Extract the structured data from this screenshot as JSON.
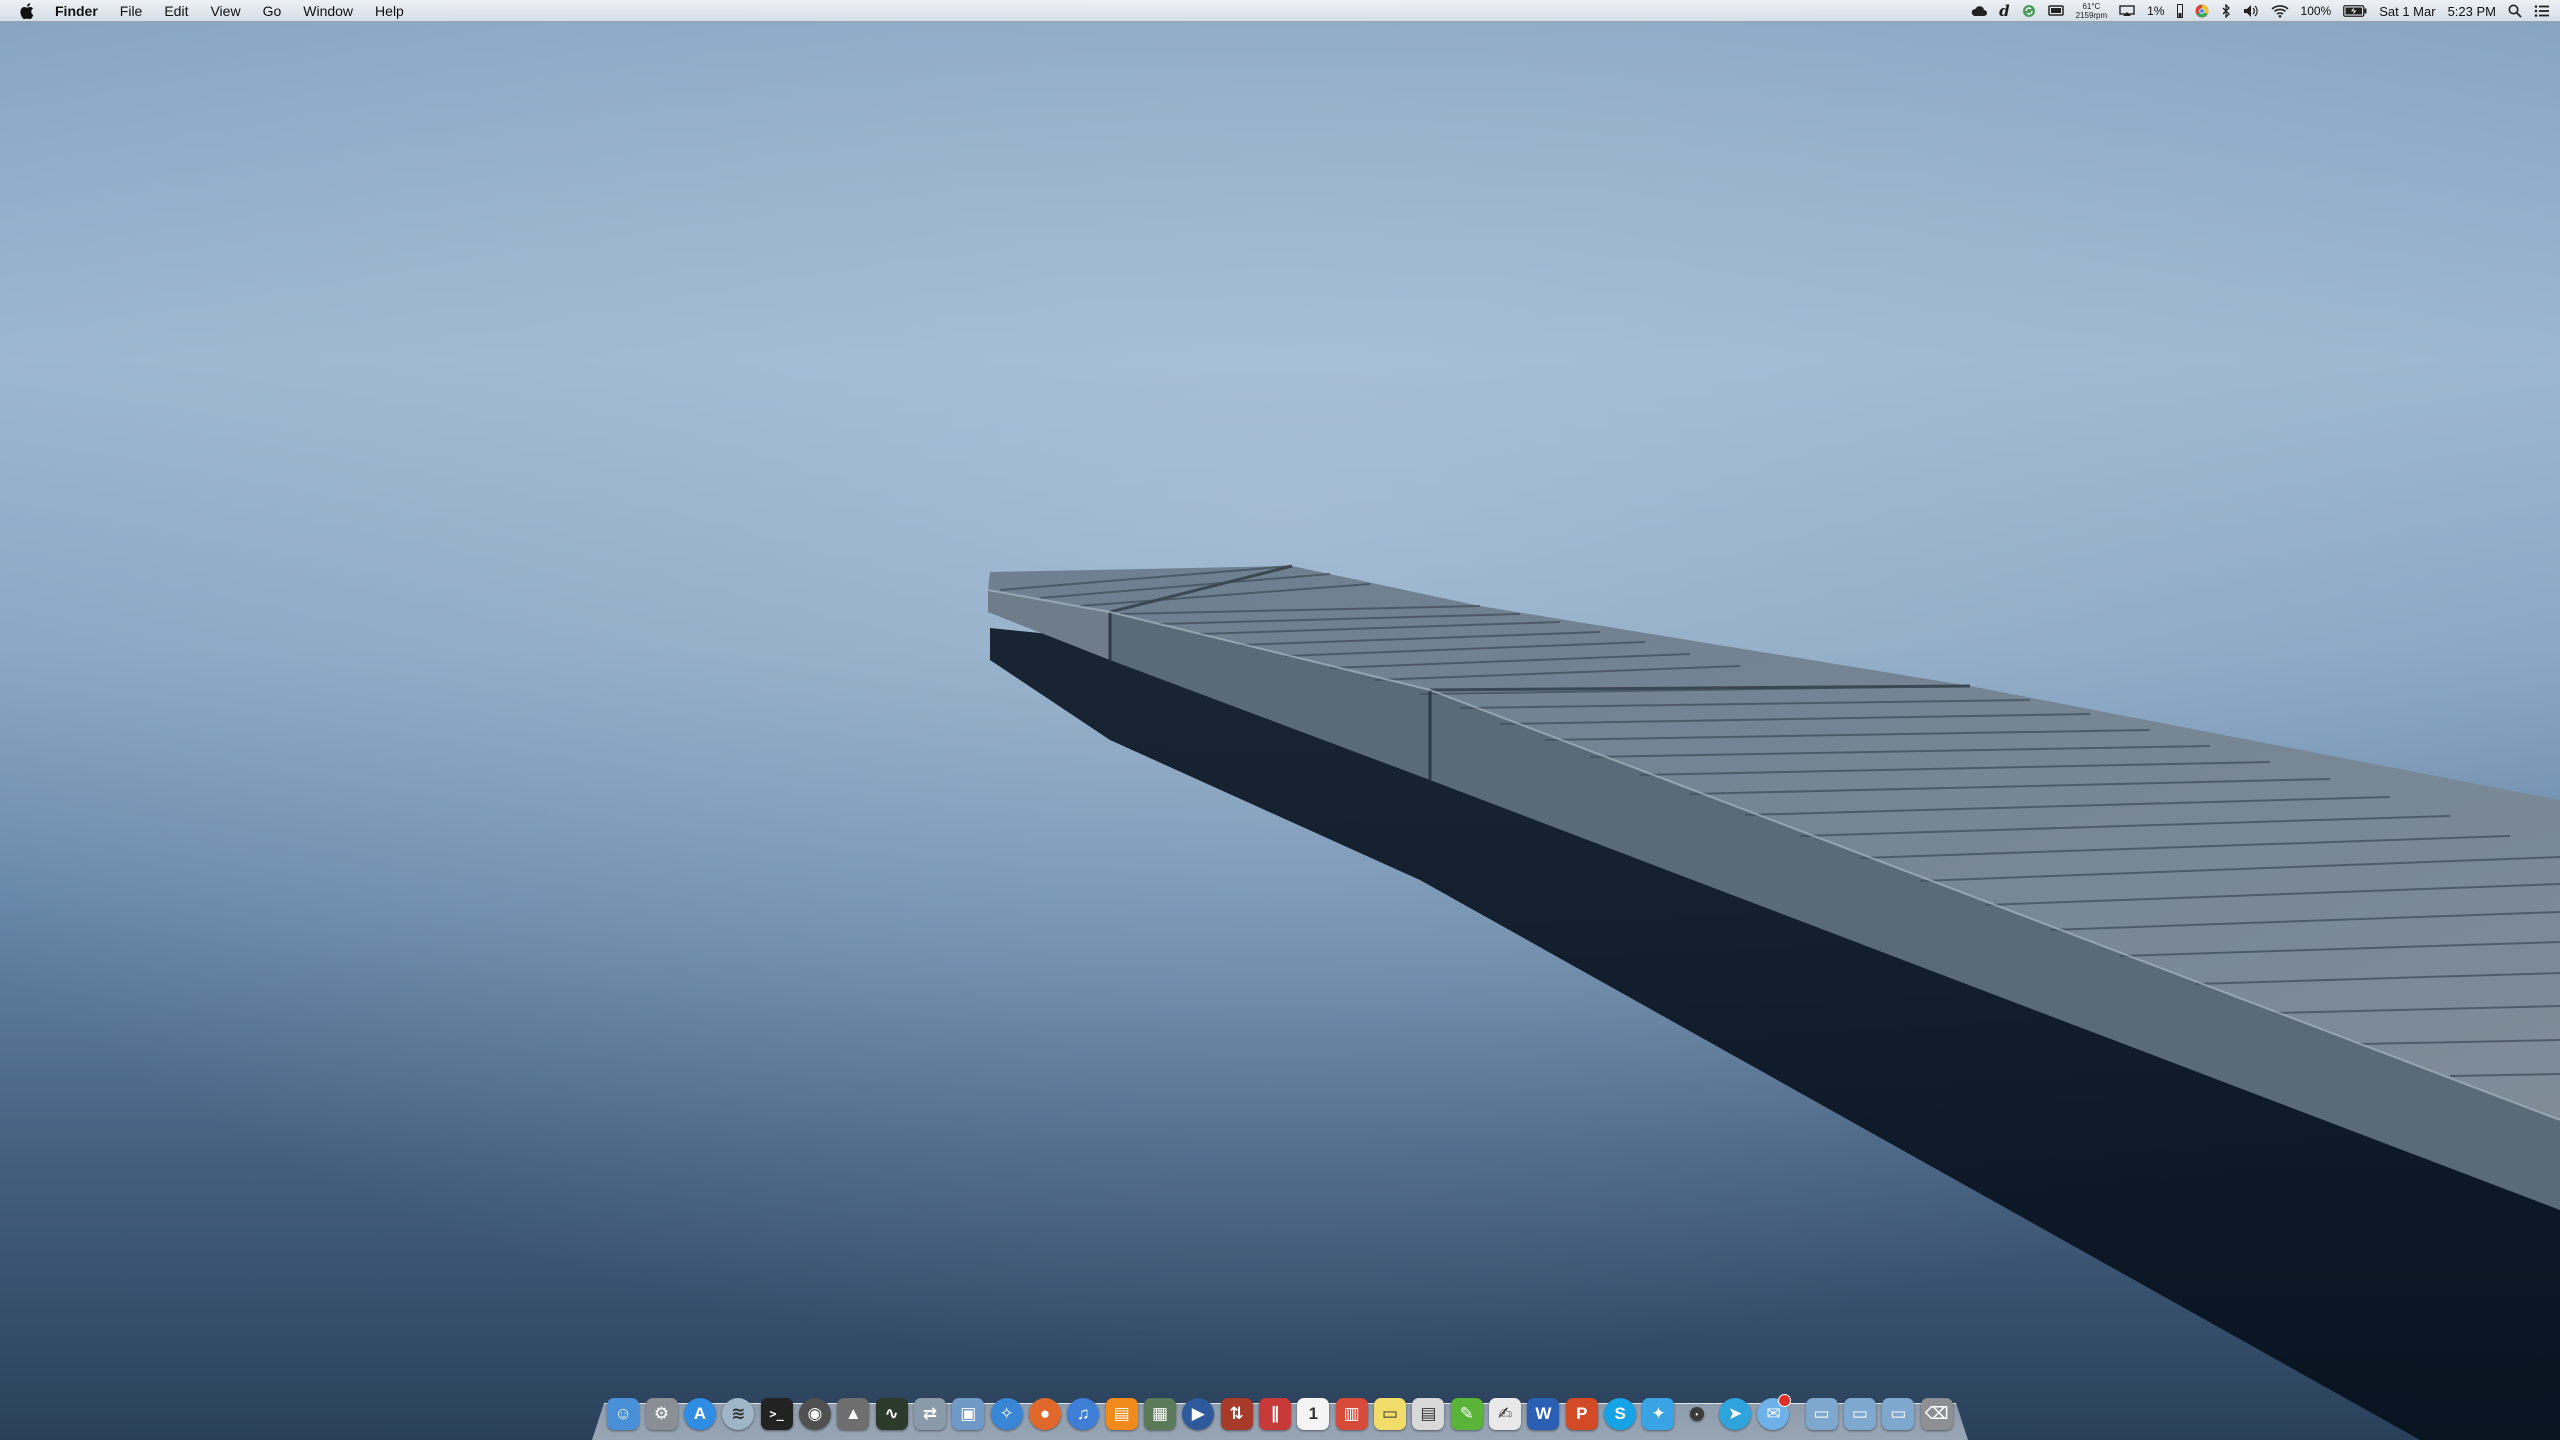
{
  "menubar": {
    "apple_icon": "apple-logo-icon",
    "app_name": "Finder",
    "menus": [
      "File",
      "Edit",
      "View",
      "Go",
      "Window",
      "Help"
    ],
    "status": {
      "icons": [
        "cloud-icon",
        "dictionary-icon",
        "recycle-icon",
        "display-icon"
      ],
      "temperature": "61°C",
      "fan_speed": "2159rpm",
      "airplay_icon": "airplay-icon",
      "cpu_percent": "1%",
      "more_icons": [
        "memory-bar-icon",
        "chrome-icon",
        "bluetooth-icon",
        "volume-icon",
        "wifi-icon"
      ],
      "battery_percent": "100%",
      "battery_icon": "battery-charging-icon",
      "date": "Sat 1 Mar",
      "time": "5:23 PM",
      "spotlight_icon": "spotlight-search-icon",
      "notification_icon": "notification-center-icon"
    }
  },
  "colors": {
    "sky_top": "#7d9cbc",
    "water_bottom": "#2d4764",
    "dock_glass": "#c4cdd7"
  },
  "dock": {
    "apps": [
      {
        "name": "finder-icon",
        "glyph": "☺",
        "color": "#4a90d9"
      },
      {
        "name": "system-preferences-icon",
        "glyph": "⚙",
        "color": "#8a8f96"
      },
      {
        "name": "app-store-icon",
        "glyph": "A",
        "color": "#2f8de4"
      },
      {
        "name": "wifi-utility-icon",
        "glyph": "≋",
        "color": "#9fb6c8"
      },
      {
        "name": "terminal-icon",
        "glyph": ">_",
        "color": "#222222"
      },
      {
        "name": "disk-utility-icon",
        "glyph": "◉",
        "color": "#505050"
      },
      {
        "name": "automator-icon",
        "glyph": "▲",
        "color": "#6e6e6e"
      },
      {
        "name": "activity-monitor-icon",
        "glyph": "∿",
        "color": "#2b3a2b"
      },
      {
        "name": "migration-assistant-icon",
        "glyph": "⇄",
        "color": "#8a9aa8"
      },
      {
        "name": "preview-icon",
        "glyph": "▣",
        "color": "#6f9ac7"
      },
      {
        "name": "safari-icon",
        "glyph": "✧",
        "color": "#3a86d6"
      },
      {
        "name": "firefox-icon",
        "glyph": "●",
        "color": "#e0682a"
      },
      {
        "name": "itunes-icon",
        "glyph": "♫",
        "color": "#3f7ed6"
      },
      {
        "name": "ibooks-icon",
        "glyph": "▤",
        "color": "#f08a1a"
      },
      {
        "name": "image-capture-icon",
        "glyph": "▦",
        "color": "#5a7a5a"
      },
      {
        "name": "quicktime-icon",
        "glyph": "▶",
        "color": "#2e5a9c"
      },
      {
        "name": "filezilla-icon",
        "glyph": "⇅",
        "color": "#a83a2a"
      },
      {
        "name": "parallels-icon",
        "glyph": "∥",
        "color": "#c83a3a"
      },
      {
        "name": "calendar-icon",
        "glyph": "1",
        "color": "#f4f4f4"
      },
      {
        "name": "flashcards-icon",
        "glyph": "▥",
        "color": "#d64a3a"
      },
      {
        "name": "stickies-icon",
        "glyph": "▭",
        "color": "#f2dc6a"
      },
      {
        "name": "contacts-icon",
        "glyph": "▤",
        "color": "#d9d9d9"
      },
      {
        "name": "evernote-icon",
        "glyph": "✎",
        "color": "#5ab43a"
      },
      {
        "name": "textedit-icon",
        "glyph": "✍",
        "color": "#e9e9e9"
      },
      {
        "name": "word-icon",
        "glyph": "W",
        "color": "#2b5fb4"
      },
      {
        "name": "powerpoint-icon",
        "glyph": "P",
        "color": "#d24a26"
      },
      {
        "name": "skype-icon",
        "glyph": "S",
        "color": "#15a3e6"
      },
      {
        "name": "twitter-icon",
        "glyph": "✦",
        "color": "#3aa3e6"
      },
      {
        "name": "alfred-icon",
        "glyph": "•",
        "color": "#3a3a3a"
      },
      {
        "name": "telegram-icon",
        "glyph": "➤",
        "color": "#2fa3dc"
      },
      {
        "name": "messages-icon",
        "glyph": "✉",
        "color": "#6db1e8"
      }
    ],
    "stacks": [
      {
        "name": "applications-folder-icon",
        "glyph": "▭",
        "color": "#7fa8cf"
      },
      {
        "name": "documents-folder-icon",
        "glyph": "▭",
        "color": "#7fa8cf"
      },
      {
        "name": "downloads-folder-icon",
        "glyph": "▭",
        "color": "#7fa8cf"
      },
      {
        "name": "trash-icon",
        "glyph": "⌫",
        "color": "#8d8f92"
      }
    ]
  }
}
